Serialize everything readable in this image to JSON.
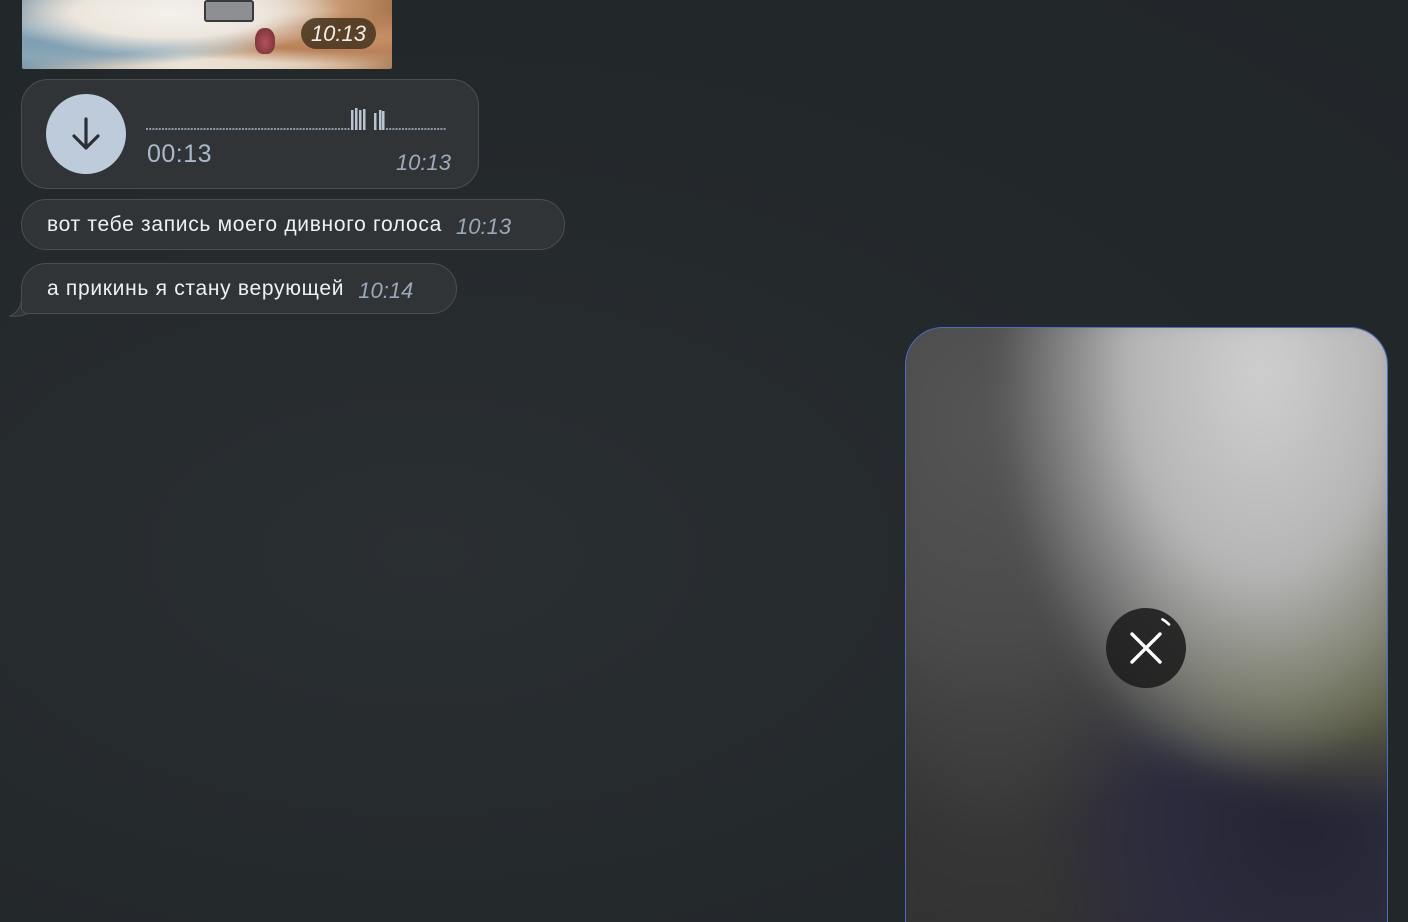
{
  "photo_message": {
    "time": "10:13"
  },
  "voice_message": {
    "duration": "00:13",
    "time": "10:13",
    "action_icon": "download-arrow-icon"
  },
  "text_messages": [
    {
      "text": "вот тебе запись моего дивного голоса",
      "time": "10:13"
    },
    {
      "text": "а прикинь я стану верующей",
      "time": "10:14"
    }
  ],
  "media_upload": {
    "action_icon": "close-icon",
    "progress_fraction": 0.04
  },
  "colors": {
    "background": "#252a2d",
    "bubble": "#303437",
    "voice_button": "#bdcbdb",
    "accent_border": "#4a6cc7"
  }
}
